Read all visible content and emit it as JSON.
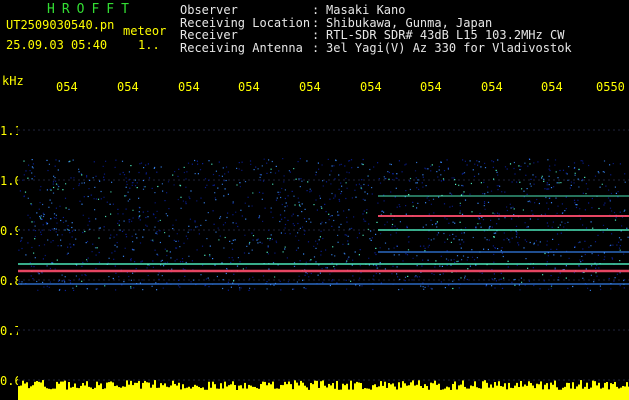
{
  "header": {
    "title": "HROFFT",
    "filename": "UT2509030540.pn",
    "event_type": "meteor",
    "datetime": "25.09.03 05:40",
    "count": "1..",
    "info": [
      {
        "key": "Observer",
        "sep": ":",
        "value": "Masaki Kano"
      },
      {
        "key": "Receiving Location",
        "sep": ":",
        "value": "Shibukawa, Gunma, Japan"
      },
      {
        "key": "Receiver",
        "sep": ":",
        "value": "RTL-SDR SDR# 43dB L15 103.2MHz CW"
      },
      {
        "key": "Receiving Antenna",
        "sep": ":",
        "value": "3el Yagi(V) Az 330 for Vladivostok"
      }
    ]
  },
  "axis": {
    "y_unit": "kHz",
    "y_ticks": [
      "1.1",
      "1.0",
      "0.9",
      "0.8",
      "0.7",
      "0.6"
    ],
    "x_ticks": [
      "054",
      "054",
      "054",
      "054",
      "054",
      "054",
      "054",
      "054",
      "054",
      "0550"
    ]
  },
  "colors": {
    "background": "#000000",
    "noise_low": "#0a1f9a",
    "noise_mid": "#3a8cff",
    "signal_mid": "#55ffcc",
    "signal_high": "#ff4d6d",
    "baseline": "#ffff00",
    "grid": "#3f4b7a"
  }
}
